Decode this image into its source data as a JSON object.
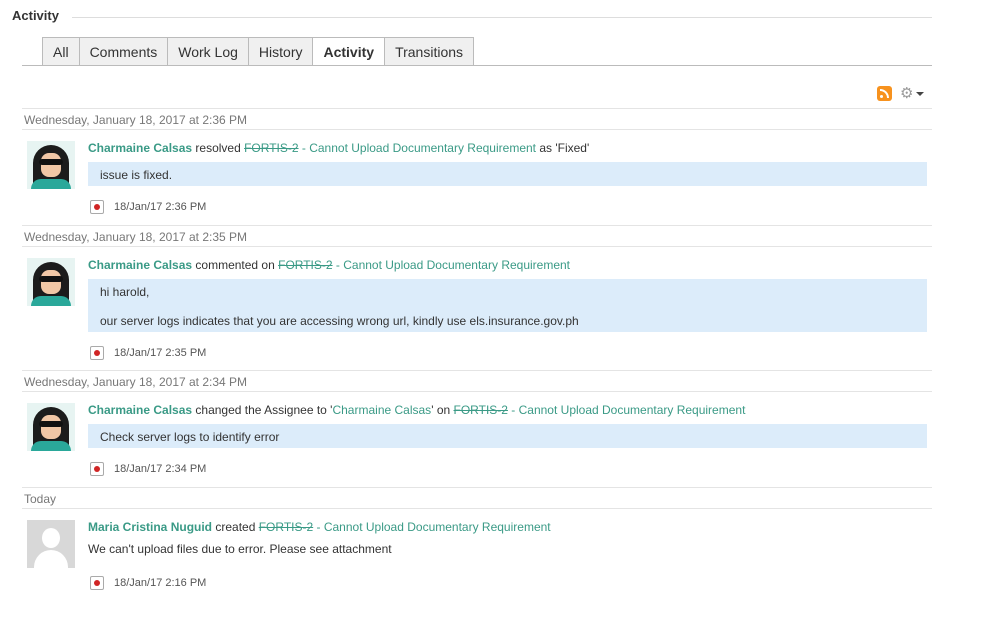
{
  "section": {
    "title": "Activity"
  },
  "tabs": [
    {
      "label": "All"
    },
    {
      "label": "Comments"
    },
    {
      "label": "Work Log"
    },
    {
      "label": "History"
    },
    {
      "label": "Activity"
    },
    {
      "label": "Transitions"
    }
  ],
  "active_tab": "Activity",
  "toolbar": {
    "rss_icon": "rss-feed-icon",
    "settings_icon": "gear-icon"
  },
  "colors": {
    "user_link": "#3a9a86",
    "comment_bg": "#dcecfa",
    "rss": "#f7921e"
  },
  "entries": [
    {
      "date_header": "Wednesday, January 18, 2017 at 2:36 PM",
      "user": "Charmaine Calsas",
      "action": " resolved ",
      "issue_key": "FORTIS-2",
      "issue_title": " - Cannot Upload Documentary Requirement",
      "suffix": " as 'Fixed'",
      "comment": [
        "issue is fixed."
      ],
      "time": "18/Jan/17 2:36 PM"
    },
    {
      "date_header": "Wednesday, January 18, 2017 at 2:35 PM",
      "user": "Charmaine Calsas",
      "action": " commented on ",
      "issue_key": "FORTIS-2",
      "issue_title": " - Cannot Upload Documentary Requirement",
      "comment": [
        "hi harold,",
        "our server logs indicates that you are accessing wrong url, kindly use els.insurance.gov.ph"
      ],
      "time": "18/Jan/17 2:35 PM"
    },
    {
      "date_header": "Wednesday, January 18, 2017 at 2:34 PM",
      "user": "Charmaine Calsas",
      "action": " changed the Assignee to '",
      "assignee": "Charmaine Calsas",
      "action2": "' on ",
      "issue_key": "FORTIS-2",
      "issue_title": " - Cannot Upload Documentary Requirement",
      "comment": [
        "Check server logs to identify error"
      ],
      "time": "18/Jan/17 2:34 PM"
    },
    {
      "date_header": "Today",
      "user": "Maria Cristina Nuguid",
      "action": " created ",
      "issue_key": "FORTIS-2",
      "issue_title": " - Cannot Upload Documentary Requirement",
      "description": "We can't upload files due to error. Please see attachment",
      "time": "18/Jan/17 2:16 PM"
    }
  ]
}
